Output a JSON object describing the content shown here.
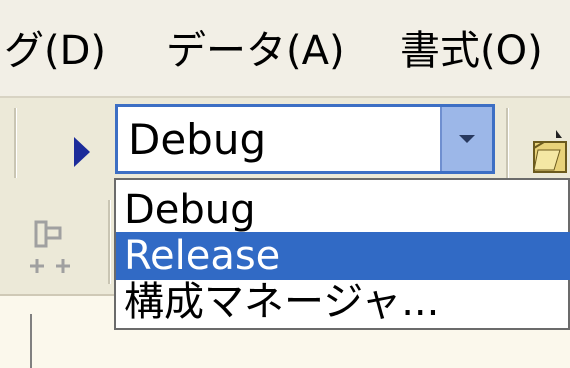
{
  "menubar": {
    "items": [
      "グ(D)",
      "データ(A)",
      "書式(O)"
    ]
  },
  "toolbar": {
    "configuration": {
      "selected": "Debug",
      "options": [
        "Debug",
        "Release",
        "構成マネージャ..."
      ],
      "highlighted_index": 1
    }
  },
  "colors": {
    "selection": "#316ac5",
    "combo_border": "#3d6fc4",
    "combo_button": "#9cb7e8",
    "toolbar_bg": "#ece9d8"
  }
}
